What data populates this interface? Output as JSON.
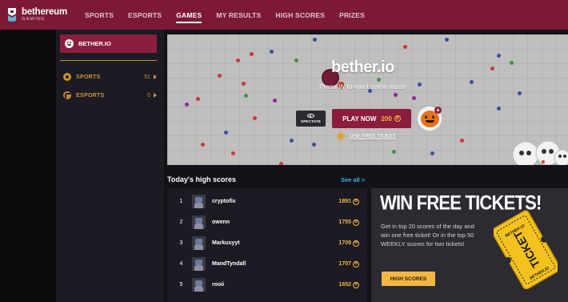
{
  "brand": {
    "name": "bethereum",
    "tagline": "GAMING"
  },
  "nav": {
    "items": [
      {
        "label": "SPORTS",
        "active": false
      },
      {
        "label": "ESPORTS",
        "active": false
      },
      {
        "label": "GAMES",
        "active": true
      },
      {
        "label": "MY RESULTS",
        "active": false
      },
      {
        "label": "HIGH SCORES",
        "active": false
      },
      {
        "label": "PRIZES",
        "active": false
      }
    ]
  },
  "sidebar": {
    "active_game": "BETHER.IO",
    "categories": [
      {
        "label": "SPORTS",
        "count": "51",
        "icon": "soccer-ball-icon"
      },
      {
        "label": "ESPORTS",
        "count": "0",
        "icon": "esports-icon"
      }
    ]
  },
  "game": {
    "title": "bether.io",
    "hint": "Press W to eject some mass",
    "spectate_label": "SPECTATE",
    "play_label": "PLAY NOW",
    "play_cost": "200",
    "free_ticket_label": "USE FREE TICKET",
    "plus_label": "+"
  },
  "high_scores": {
    "title": "Today's high scores",
    "see_all": "See all >",
    "rows": [
      {
        "rank": "1",
        "name": "cryptofix",
        "score": "1891"
      },
      {
        "rank": "2",
        "name": "owenn",
        "score": "1755"
      },
      {
        "rank": "3",
        "name": "Markusyyt",
        "score": "1709"
      },
      {
        "rank": "4",
        "name": "MandTyndall",
        "score": "1707"
      },
      {
        "rank": "5",
        "name": "rooii",
        "score": "1652"
      }
    ]
  },
  "promo": {
    "title": "WIN FREE TICKETS!",
    "text": "Get in top 20 scores of the day and win one free ticket! Or in the top 50 WEEKLY scores for two tickets!",
    "button": "HIGH SCORES",
    "ticket_text": "TICKET",
    "ticket_small_top": "BETHER.IO",
    "ticket_small_bottom": "BETHER.IO"
  },
  "colors": {
    "brand": "#7c1a35",
    "accent": "#8b1e3c",
    "gold": "#f4b842",
    "link": "#3db4e8"
  }
}
